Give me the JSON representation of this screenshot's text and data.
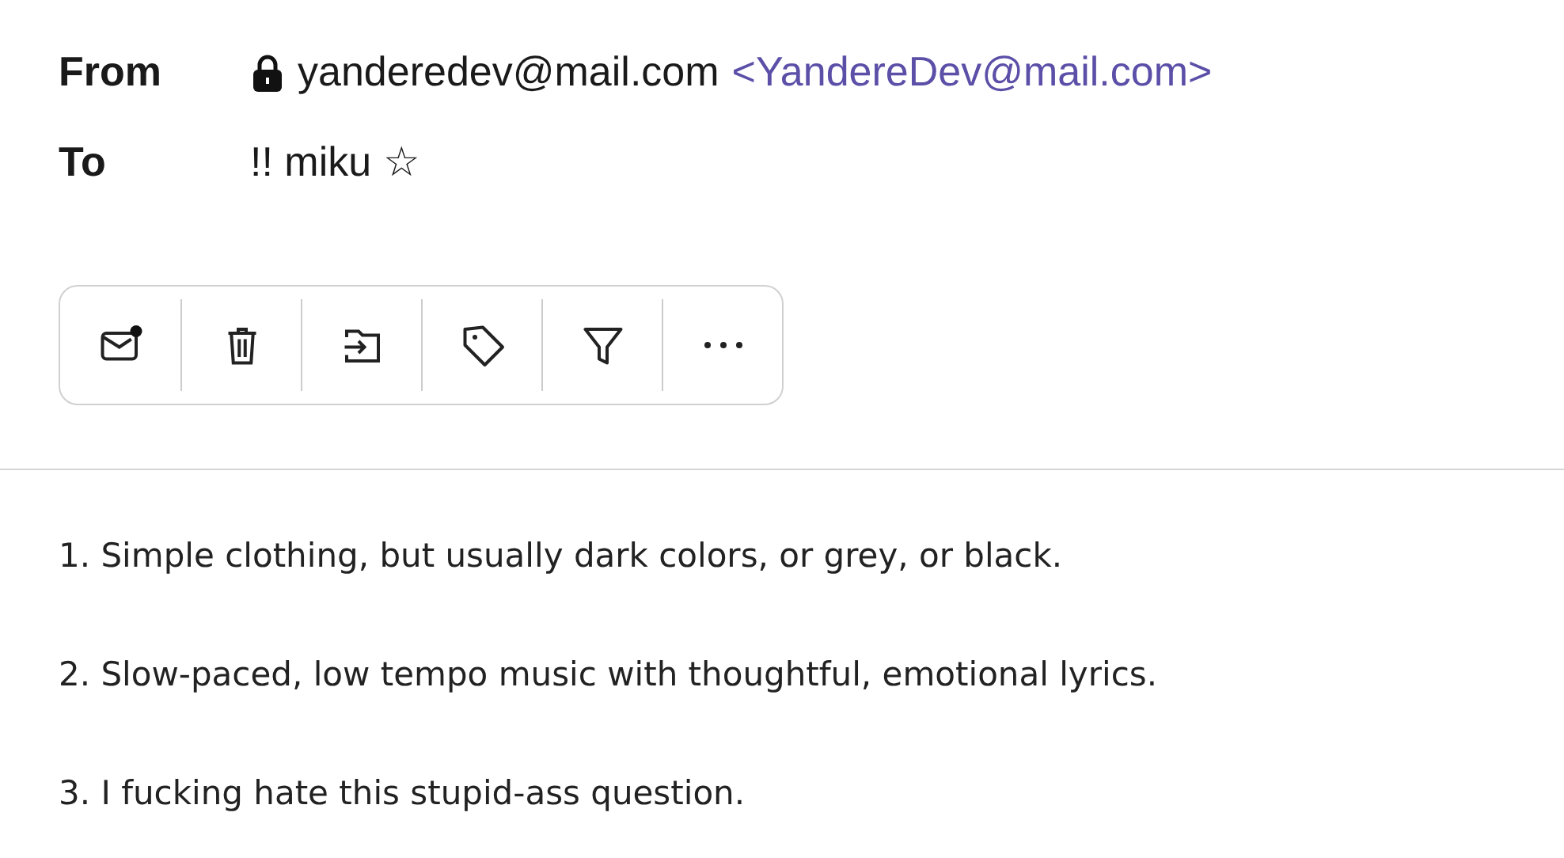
{
  "header": {
    "from_label": "From",
    "from_name": "yanderedev@mail.com",
    "from_address": "<YandereDev@mail.com>",
    "to_label": "To",
    "to_value": "!! miku ☆"
  },
  "toolbar": [
    {
      "kind": "unread"
    },
    {
      "kind": "delete"
    },
    {
      "kind": "move"
    },
    {
      "kind": "tag"
    },
    {
      "kind": "filter"
    },
    {
      "kind": "more"
    }
  ],
  "body": [
    "1. Simple clothing, but usually dark colors, or grey, or black.",
    "2. Slow-paced, low tempo music with thoughtful, emotional lyrics.",
    "3. I fucking hate this stupid-ass question."
  ]
}
